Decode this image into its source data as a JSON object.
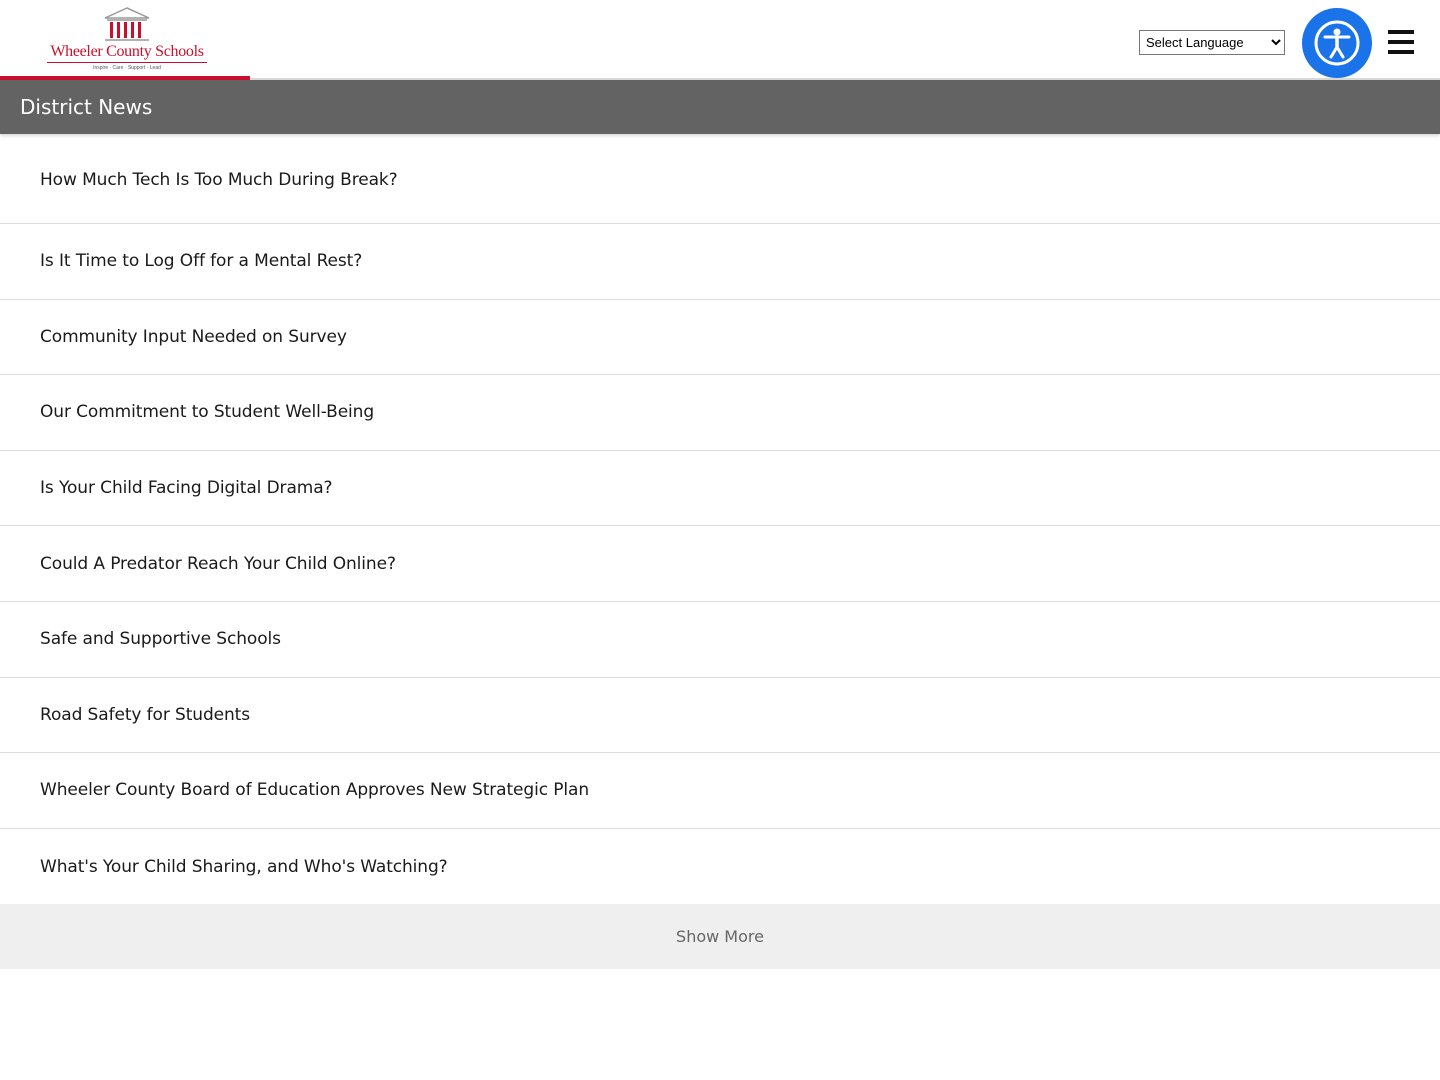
{
  "header": {
    "logo": {
      "name": "Wheeler County Schools",
      "tagline": "Inspire · Care · Support · Lead"
    },
    "language_select": {
      "selected": "Select Language",
      "options": [
        "Select Language"
      ]
    },
    "accessibility_button": {
      "icon": "accessibility-person-icon"
    },
    "menu_button": {
      "icon": "hamburger-menu-icon"
    },
    "colors": {
      "brand_red": "#c8102e",
      "accessibility_blue": "#1a73e8"
    }
  },
  "section": {
    "title": "District News"
  },
  "news": {
    "items": [
      {
        "title": "How Much Tech Is Too Much During Break?"
      },
      {
        "title": "Is It Time to Log Off for a Mental Rest?"
      },
      {
        "title": "Community Input Needed on Survey"
      },
      {
        "title": "Our Commitment to Student Well-Being"
      },
      {
        "title": "Is Your Child Facing Digital Drama?"
      },
      {
        "title": "Could A Predator Reach Your Child Online?"
      },
      {
        "title": "Safe and Supportive Schools"
      },
      {
        "title": "Road Safety for Students"
      },
      {
        "title": "Wheeler County Board of Education Approves New Strategic Plan"
      },
      {
        "title": "What's Your Child Sharing, and Who's Watching?"
      }
    ],
    "show_more_label": "Show More"
  }
}
